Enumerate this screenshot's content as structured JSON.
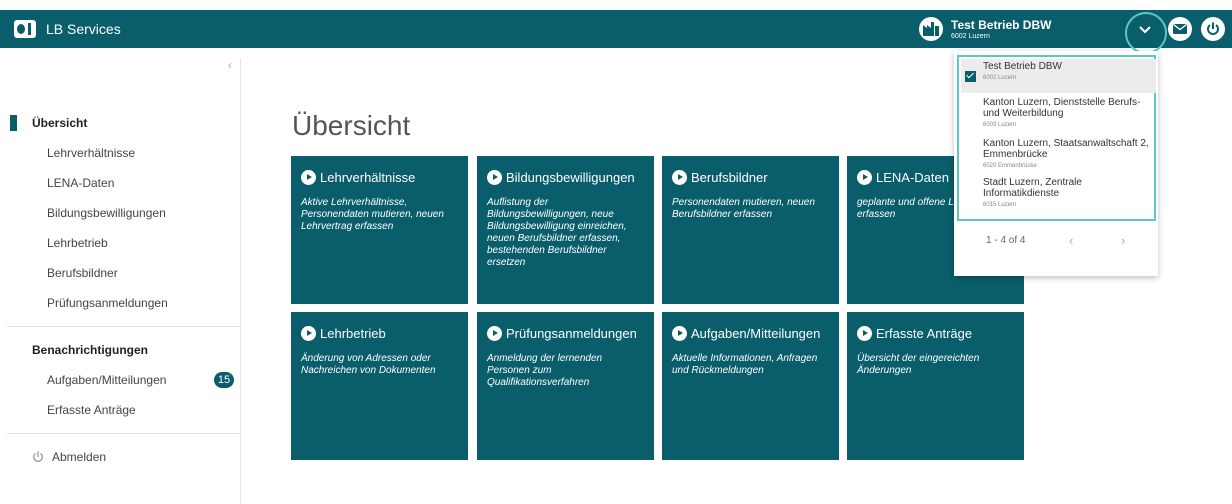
{
  "header": {
    "app_title": "LB Services",
    "company_name": "Test Betrieb DBW",
    "company_location": "6002 Luzern"
  },
  "sidebar": {
    "overview_label": "Übersicht",
    "items": [
      {
        "label": "Lehrverhältnisse"
      },
      {
        "label": "LENA-Daten"
      },
      {
        "label": "Bildungsbewilligungen"
      },
      {
        "label": "Lehrbetrieb"
      },
      {
        "label": "Berufsbildner"
      },
      {
        "label": "Prüfungsanmeldungen"
      }
    ],
    "notifications_label": "Benachrichtigungen",
    "notification_items": [
      {
        "label": "Aufgaben/Mitteilungen",
        "badge": "15"
      },
      {
        "label": "Erfasste Anträge"
      }
    ],
    "logout_label": "Abmelden"
  },
  "main": {
    "title": "Übersicht",
    "tiles": [
      {
        "title": "Lehrverhältnisse",
        "desc": "Aktive Lehrverhältnisse, Personendaten mutieren, neuen Lehrvertrag erfassen"
      },
      {
        "title": "Bildungsbewilligungen",
        "desc": "Auflistung der Bildungsbewilligungen, neue Bildungsbewilligung einreichen, neuen Berufsbildner erfassen, bestehenden Berufsbildner ersetzen"
      },
      {
        "title": "Berufsbildner",
        "desc": "Personendaten mutieren, neuen Berufsbildner erfassen"
      },
      {
        "title": "LENA-Daten",
        "desc": "geplante und offene Lehrstellen erfassen"
      },
      {
        "title": "Lehrbetrieb",
        "desc": "Änderung von Adressen oder Nachreichen von Dokumenten"
      },
      {
        "title": "Prüfungsanmeldungen",
        "desc": "Anmeldung der lernenden Personen zum Qualifikationsverfahren"
      },
      {
        "title": "Aufgaben/Mitteilungen",
        "desc": "Aktuelle Informationen, Anfragen und Rückmeldungen"
      },
      {
        "title": "Erfasste Anträge",
        "desc": "Übersicht der eingereichten Änderungen"
      }
    ]
  },
  "dropdown": {
    "options": [
      {
        "name": "Test Betrieb DBW",
        "location": "6002 Luzern",
        "selected": true
      },
      {
        "name": "Kanton Luzern, Dienststelle Berufs- und Weiterbildung",
        "location": "6003 Luzern"
      },
      {
        "name": "Kanton Luzern, Staatsanwaltschaft 2, Emmenbrücke",
        "location": "6020 Emmenbrücke"
      },
      {
        "name": "Stadt Luzern, Zentrale Informatikdienste",
        "location": "6015 Luzern"
      }
    ],
    "pager_text": "1 - 4 of 4",
    "prev": "‹",
    "next": "›"
  },
  "colors": {
    "primary": "#0a5e6b",
    "highlight": "#5cc7c3"
  }
}
